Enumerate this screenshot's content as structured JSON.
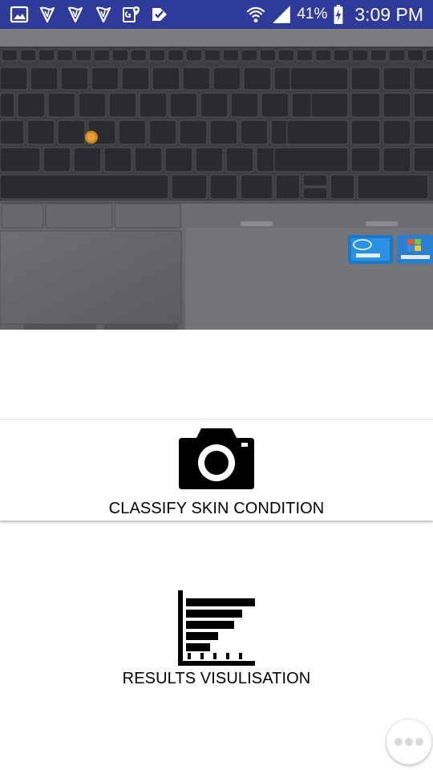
{
  "status_bar": {
    "background": "#2f3b9a",
    "left_icons": [
      "gallery-icon",
      "harp-icon",
      "harp-icon",
      "harp-icon",
      "maps-icon",
      "check-icon"
    ],
    "right_icons": [
      "wifi-icon",
      "cell-signal-icon",
      "battery-charging-icon"
    ],
    "battery_percent": "41%",
    "time": "3:09 PM"
  },
  "photo": {
    "subject": "laptop-keyboard-photo"
  },
  "actions": {
    "classify": {
      "icon": "camera-icon",
      "label": "CLASSIFY SKIN CONDITION"
    },
    "results": {
      "icon": "bar-chart-icon",
      "label": "RESULTS VISULISATION"
    }
  },
  "more_button": {
    "icon": "more-dots-icon"
  }
}
